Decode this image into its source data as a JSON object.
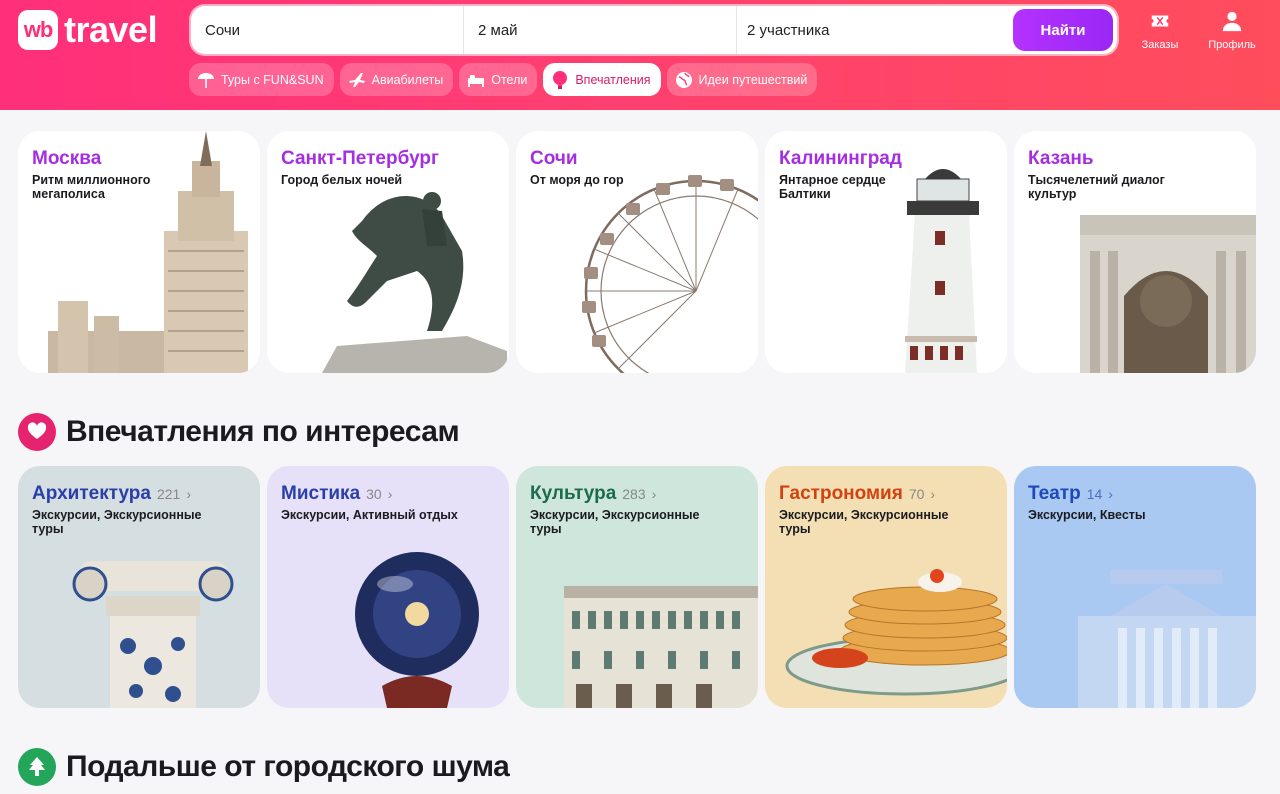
{
  "header": {
    "logo_badge": "wb",
    "logo_text": "travel",
    "search": {
      "destination": "Сочи",
      "date": "2 май",
      "participants": "2 участника",
      "button": "Найти"
    },
    "actions": [
      {
        "label": "Заказы",
        "icon": "ticket-icon"
      },
      {
        "label": "Профиль",
        "icon": "user-icon"
      }
    ],
    "chips": [
      {
        "label": "Туры с FUN&SUN",
        "icon": "beach-umbrella-icon",
        "active": false
      },
      {
        "label": "Авиабилеты",
        "icon": "airplane-icon",
        "active": false
      },
      {
        "label": "Отели",
        "icon": "bed-icon",
        "active": false
      },
      {
        "label": "Впечатления",
        "icon": "balloon-icon",
        "active": true
      },
      {
        "label": "Идеи путешествий",
        "icon": "globe-icon",
        "active": false
      }
    ]
  },
  "cities": [
    {
      "title": "Москва",
      "subtitle": "Ритм миллионного мегаполиса"
    },
    {
      "title": "Санкт-Петербург",
      "subtitle": "Город белых ночей"
    },
    {
      "title": "Сочи",
      "subtitle": "От моря до гор"
    },
    {
      "title": "Калининград",
      "subtitle": "Янтарное сердце Балтики"
    },
    {
      "title": "Казань",
      "subtitle": "Тысячелетний диалог культур"
    }
  ],
  "interests_section": {
    "title": "Впечатления по интересам",
    "icon": "heart-icon"
  },
  "interests": [
    {
      "title": "Архитектура",
      "count": "221",
      "subtitle": "Экскурсии, Экскурсионные туры",
      "color": "#2a3fa8",
      "bg": "#d5dee0"
    },
    {
      "title": "Мистика",
      "count": "30",
      "subtitle": "Экскурсии, Активный отдых",
      "color": "#2a3fa8",
      "bg": "#e6e1f8"
    },
    {
      "title": "Культура",
      "count": "283",
      "subtitle": "Экскурсии, Экскурсионные туры",
      "color": "#1c6b4a",
      "bg": "#cfe6dc"
    },
    {
      "title": "Гастрономия",
      "count": "70",
      "subtitle": "Экскурсии, Экскурсионные туры",
      "color": "#d2410f",
      "bg": "#f3dfb3"
    },
    {
      "title": "Театр",
      "count": "14",
      "subtitle": "Экскурсии, Квесты",
      "color": "#1e49b8",
      "bg": "#a9c8f2"
    }
  ],
  "nature_section": {
    "title": "Подальше от городского шума",
    "icon": "tree-icon"
  }
}
